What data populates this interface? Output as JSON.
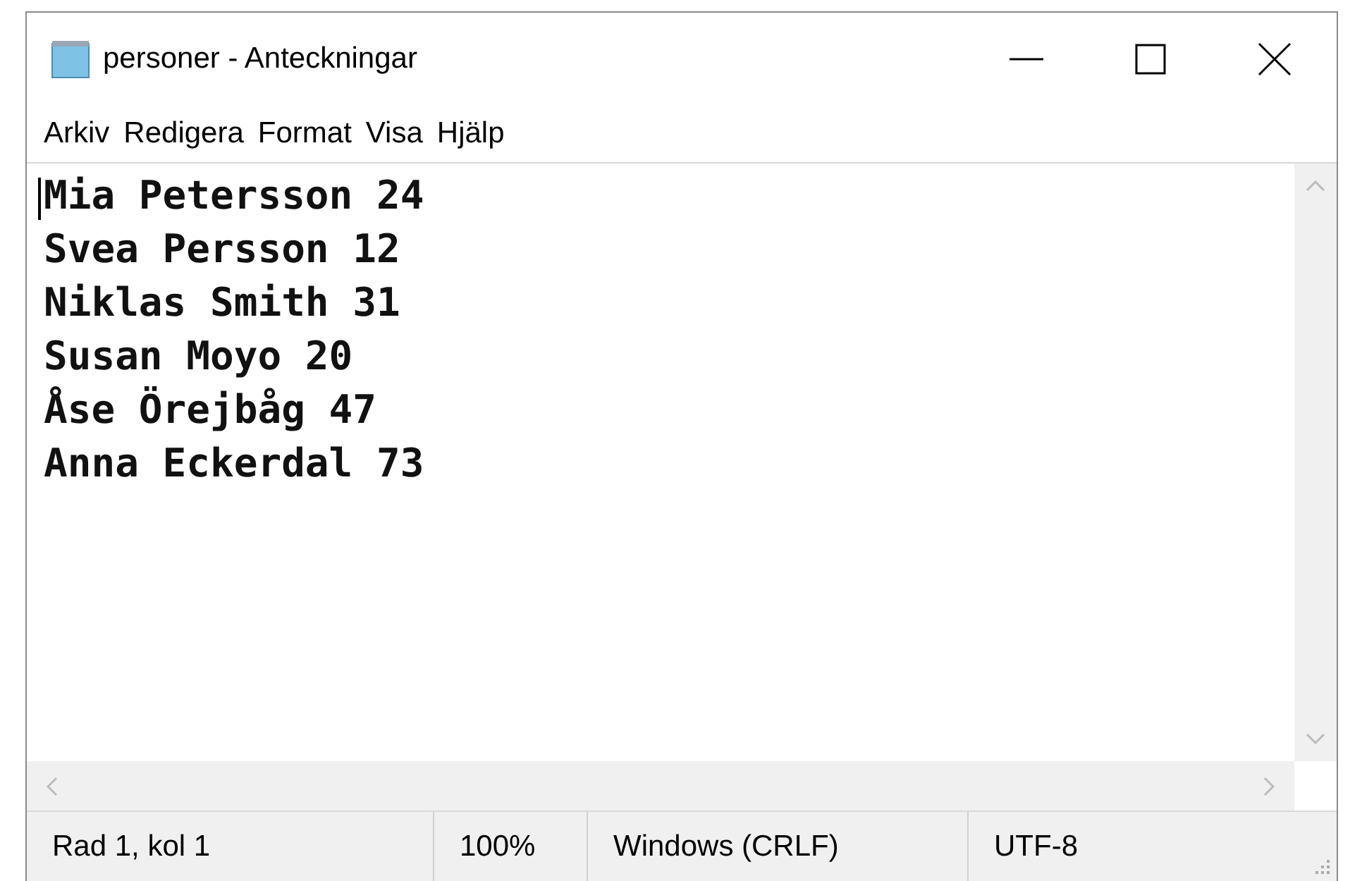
{
  "window": {
    "title": "personer - Anteckningar"
  },
  "menu": [
    "Arkiv",
    "Redigera",
    "Format",
    "Visa",
    "Hjälp"
  ],
  "editor": {
    "lines": [
      "Mia Petersson 24",
      "Svea Persson 12",
      "Niklas Smith 31",
      "Susan Moyo 20",
      "Åse Örejbåg 47",
      "Anna Eckerdal 73"
    ]
  },
  "status_bar": [
    "Rad 1, kol 1",
    "100%",
    "Windows (CRLF)",
    "UTF-8"
  ]
}
